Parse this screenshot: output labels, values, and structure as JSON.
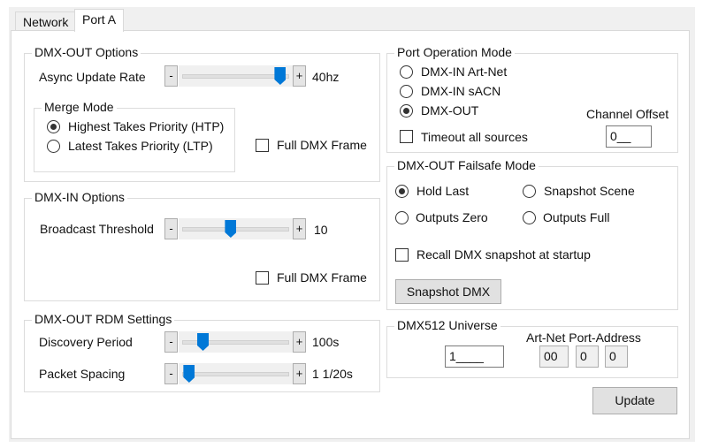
{
  "tabs": [
    {
      "label": "Network",
      "active": false
    },
    {
      "label": "Port A",
      "active": true
    }
  ],
  "dmx_out_options": {
    "title": "DMX-OUT Options",
    "async_label": "Async Update Rate",
    "async_value": "40hz",
    "async_fraction": 0.95,
    "minus": "-",
    "plus": "+",
    "merge_mode": {
      "title": "Merge Mode",
      "options": [
        "Highest Takes Priority (HTP)",
        "Latest Takes Priority (LTP)"
      ],
      "selected": 0
    },
    "full_frame_label": "Full DMX Frame",
    "full_frame_checked": false
  },
  "dmx_in_options": {
    "title": "DMX-IN Options",
    "threshold_label": "Broadcast Threshold",
    "threshold_value": "10",
    "threshold_fraction": 0.45,
    "full_frame_label": "Full DMX Frame",
    "full_frame_checked": false
  },
  "rdm": {
    "title": "DMX-OUT RDM Settings",
    "discovery_label": "Discovery Period",
    "discovery_value": "100s",
    "discovery_fraction": 0.17,
    "spacing_label": "Packet Spacing",
    "spacing_value": "1 1/20s",
    "spacing_fraction": 0.03
  },
  "port_mode": {
    "title": "Port Operation Mode",
    "options": [
      "DMX-IN Art-Net",
      "DMX-IN sACN",
      "DMX-OUT"
    ],
    "selected": 2,
    "timeout_label": "Timeout all sources",
    "timeout_checked": false,
    "channel_offset_label": "Channel Offset",
    "channel_offset_value": "0__"
  },
  "failsafe": {
    "title": "DMX-OUT Failsafe Mode",
    "options": [
      "Hold Last",
      "Snapshot Scene",
      "Outputs Zero",
      "Outputs Full"
    ],
    "selected": 0,
    "recall_label": "Recall DMX snapshot at startup",
    "recall_checked": false,
    "snapshot_button": "Snapshot DMX"
  },
  "universe": {
    "title": "DMX512 Universe",
    "value": "1____",
    "artnet_label": "Art-Net Port-Address",
    "artnet": [
      "00",
      "0",
      "0"
    ]
  },
  "update_button": "Update"
}
